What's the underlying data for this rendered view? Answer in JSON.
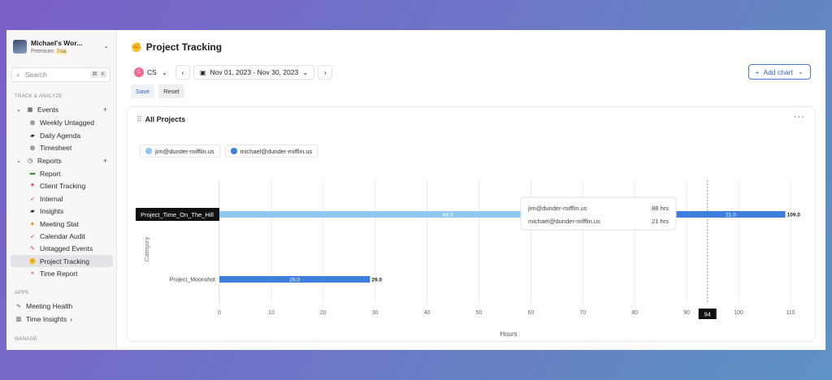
{
  "workspace": {
    "name": "Michael's Wor...",
    "plan": "Premium",
    "badge": "Trial"
  },
  "search": {
    "placeholder": "Search",
    "shortcut": [
      "⌘",
      "K"
    ]
  },
  "sidebar": {
    "section_track": "TRACK & ANALYZE",
    "events": {
      "label": "Events",
      "items": [
        "Weekly Untagged",
        "Daily Agenda",
        "Timesheet"
      ]
    },
    "reports": {
      "label": "Reports",
      "items": [
        "Report",
        "Client Tracking",
        "Internal",
        "Insights",
        "Meeting Stat",
        "Calendar Audit",
        "Untagged Events",
        "Project Tracking",
        "Time Report"
      ]
    },
    "section_apps": "APPS",
    "apps": [
      "Meeting Health",
      "Time Insights"
    ],
    "section_manage": "MANAGE"
  },
  "page": {
    "title": "Project Tracking"
  },
  "controls": {
    "user_initial": "C",
    "user_label": "CS",
    "date_range": "Nov 01, 2023 - Nov 30, 2023",
    "add_chart": "Add chart",
    "save": "Save",
    "reset": "Reset"
  },
  "card": {
    "title": "All Projects"
  },
  "tooltip": {
    "rows": [
      {
        "name": "jim@dunder-mifflin.us",
        "value": "88 hrs"
      },
      {
        "name": "michael@dunder-mifflin.us",
        "value": "21 hrs"
      }
    ],
    "category_tag": "Project_Time_On_The_Hill",
    "crosshair_value": "94"
  },
  "colors": {
    "jim": "#8ec8ef",
    "michael": "#3f7de0"
  },
  "chart_data": {
    "type": "bar",
    "orientation": "horizontal",
    "stacked": true,
    "categories": [
      "Project_Time_On_The_Hill",
      "Project_Moonshot"
    ],
    "series": [
      {
        "name": "jim@dunder-mifflin.us",
        "values": [
          88.0,
          0
        ],
        "labels": [
          "88.0",
          ""
        ]
      },
      {
        "name": "michael@dunder-mifflin.us",
        "values": [
          21.0,
          29.0
        ],
        "labels": [
          "21.0",
          "29.0"
        ]
      }
    ],
    "totals": [
      "109.0",
      "29.0"
    ],
    "xlabel": "Hours",
    "ylabel": "Category",
    "xlim": [
      0,
      110
    ],
    "xticks": [
      "0",
      "10",
      "20",
      "30",
      "40",
      "50",
      "60",
      "70",
      "80",
      "90",
      "100",
      "110"
    ],
    "grid": true,
    "legend_position": "top-left"
  }
}
